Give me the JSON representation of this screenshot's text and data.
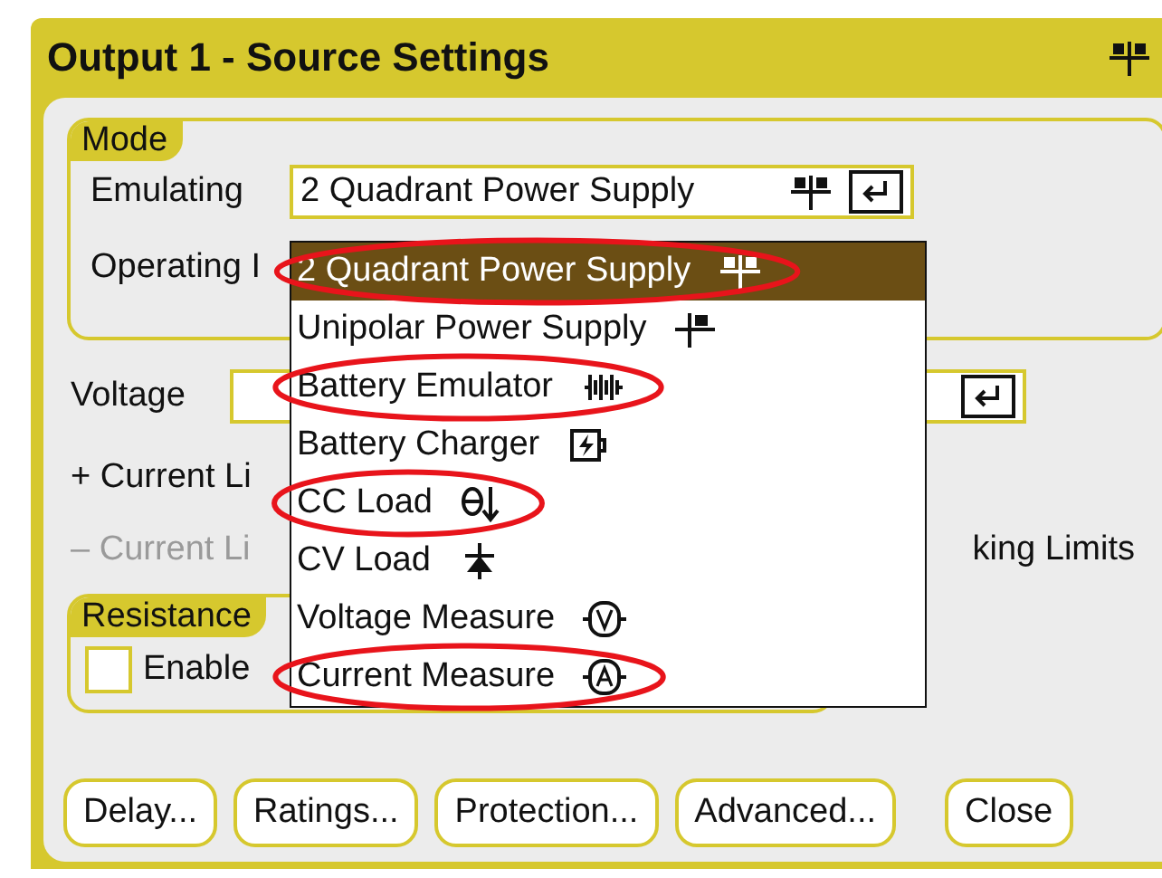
{
  "window": {
    "title": "Output 1 - Source Settings"
  },
  "mode": {
    "title": "Mode",
    "emulating": {
      "label": "Emulating",
      "value": "2 Quadrant Power Supply",
      "kind": "two-quadrant"
    },
    "operating": {
      "label": "Operating I"
    }
  },
  "voltage": {
    "label": "Voltage"
  },
  "current_limits": [
    {
      "label": "+ Current Li",
      "disabled": false
    },
    {
      "label": "– Current Li",
      "disabled": true
    }
  ],
  "tracking": {
    "label": "king Limits"
  },
  "resistance": {
    "title": "Resistance",
    "enable": {
      "label": "Enable",
      "checked": false
    }
  },
  "dropdown": {
    "items": [
      {
        "label": "2 Quadrant Power Supply",
        "kind": "two-quadrant",
        "selected": true,
        "circled": true
      },
      {
        "label": "Unipolar Power Supply",
        "kind": "unipolar",
        "selected": false,
        "circled": false
      },
      {
        "label": "Battery Emulator",
        "kind": "battery",
        "selected": false,
        "circled": true
      },
      {
        "label": "Battery Charger",
        "kind": "charger",
        "selected": false,
        "circled": false
      },
      {
        "label": "CC Load",
        "kind": "cc-load",
        "selected": false,
        "circled": true
      },
      {
        "label": "CV Load",
        "kind": "cv-load",
        "selected": false,
        "circled": false
      },
      {
        "label": "Voltage Measure",
        "kind": "voltmeter",
        "selected": false,
        "circled": false
      },
      {
        "label": "Current Measure",
        "kind": "ammeter",
        "selected": false,
        "circled": true
      }
    ]
  },
  "buttons": [
    "Delay...",
    "Ratings...",
    "Protection...",
    "Advanced...",
    "Close"
  ]
}
